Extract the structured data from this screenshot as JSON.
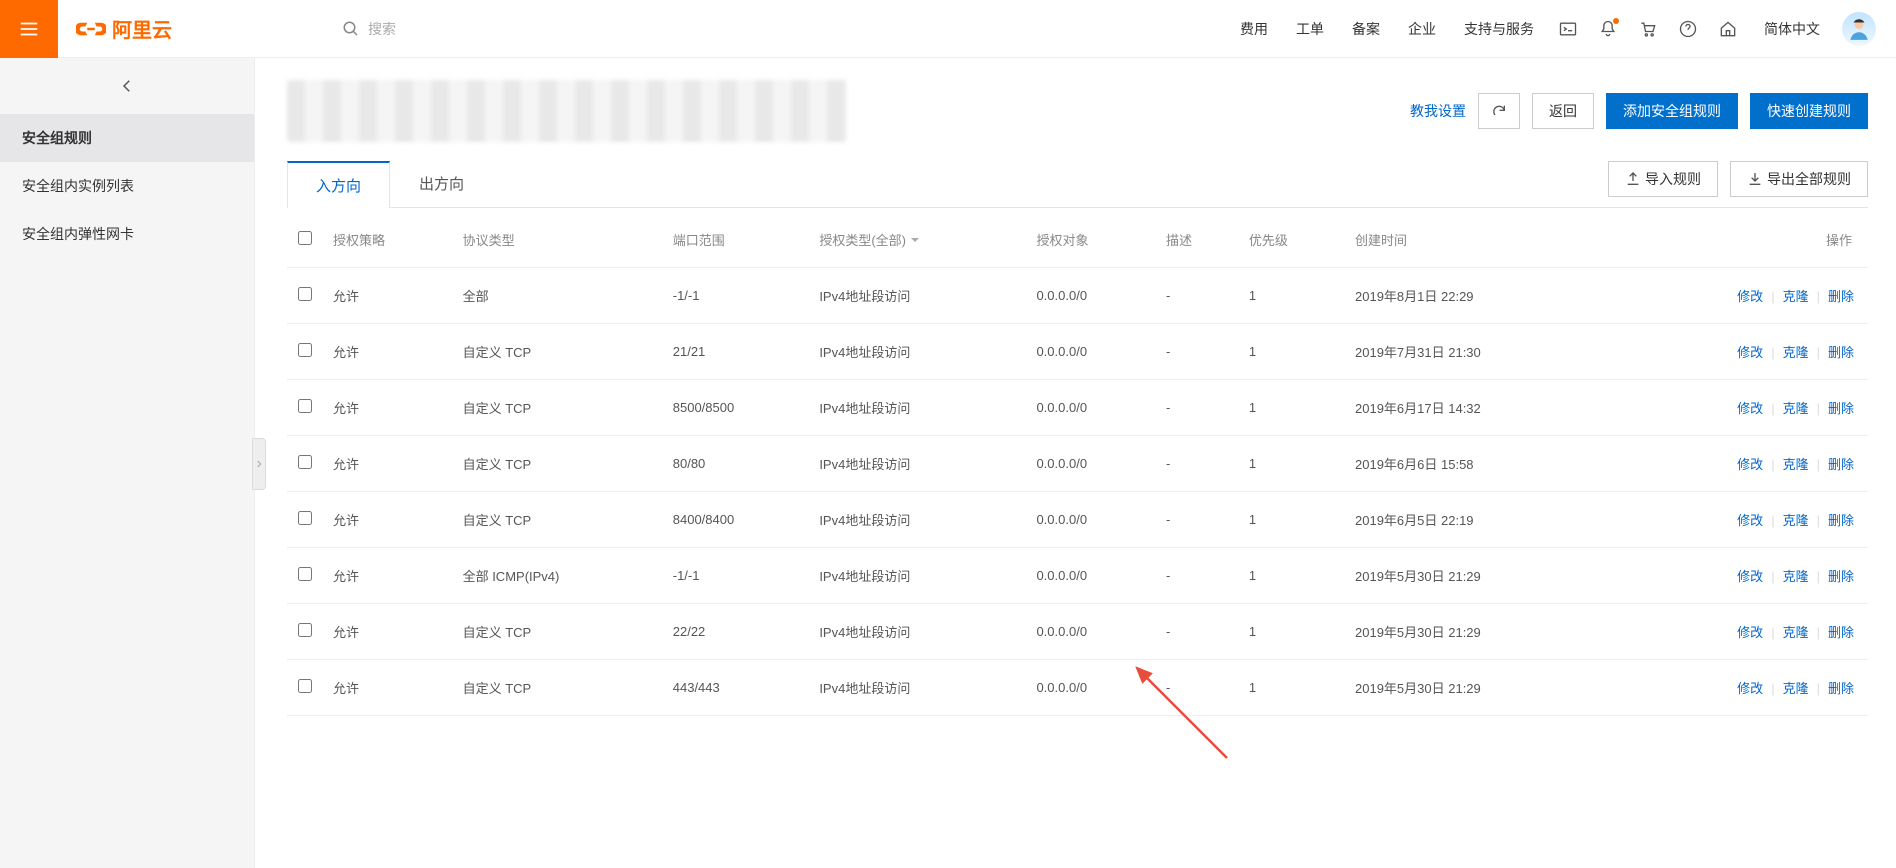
{
  "header": {
    "brand": "阿里云",
    "search_placeholder": "搜索",
    "nav": [
      "费用",
      "工单",
      "备案",
      "企业",
      "支持与服务"
    ],
    "lang": "简体中文"
  },
  "sidebar": {
    "items": [
      {
        "label": "安全组规则",
        "active": true
      },
      {
        "label": "安全组内实例列表",
        "active": false
      },
      {
        "label": "安全组内弹性网卡",
        "active": false
      }
    ]
  },
  "page": {
    "tutorial_link": "教我设置",
    "back_btn": "返回",
    "add_rule_btn": "添加安全组规则",
    "quick_create_btn": "快速创建规则",
    "import_btn": "导入规则",
    "export_btn": "导出全部规则"
  },
  "tabs": [
    {
      "label": "入方向",
      "active": true
    },
    {
      "label": "出方向",
      "active": false
    }
  ],
  "columns": {
    "policy": "授权策略",
    "protocol": "协议类型",
    "port": "端口范围",
    "auth_type": "授权类型(全部)",
    "auth_obj": "授权对象",
    "desc": "描述",
    "priority": "优先级",
    "created": "创建时间",
    "ops": "操作"
  },
  "ops": {
    "modify": "修改",
    "clone": "克隆",
    "delete": "删除"
  },
  "rows": [
    {
      "policy": "允许",
      "protocol": "全部",
      "port": "-1/-1",
      "auth_type": "IPv4地址段访问",
      "auth_obj": "0.0.0.0/0",
      "desc": "-",
      "priority": "1",
      "created": "2019年8月1日 22:29"
    },
    {
      "policy": "允许",
      "protocol": "自定义 TCP",
      "port": "21/21",
      "auth_type": "IPv4地址段访问",
      "auth_obj": "0.0.0.0/0",
      "desc": "-",
      "priority": "1",
      "created": "2019年7月31日 21:30"
    },
    {
      "policy": "允许",
      "protocol": "自定义 TCP",
      "port": "8500/8500",
      "auth_type": "IPv4地址段访问",
      "auth_obj": "0.0.0.0/0",
      "desc": "-",
      "priority": "1",
      "created": "2019年6月17日 14:32"
    },
    {
      "policy": "允许",
      "protocol": "自定义 TCP",
      "port": "80/80",
      "auth_type": "IPv4地址段访问",
      "auth_obj": "0.0.0.0/0",
      "desc": "-",
      "priority": "1",
      "created": "2019年6月6日 15:58"
    },
    {
      "policy": "允许",
      "protocol": "自定义 TCP",
      "port": "8400/8400",
      "auth_type": "IPv4地址段访问",
      "auth_obj": "0.0.0.0/0",
      "desc": "-",
      "priority": "1",
      "created": "2019年6月5日 22:19"
    },
    {
      "policy": "允许",
      "protocol": "全部 ICMP(IPv4)",
      "port": "-1/-1",
      "auth_type": "IPv4地址段访问",
      "auth_obj": "0.0.0.0/0",
      "desc": "-",
      "priority": "1",
      "created": "2019年5月30日 21:29"
    },
    {
      "policy": "允许",
      "protocol": "自定义 TCP",
      "port": "22/22",
      "auth_type": "IPv4地址段访问",
      "auth_obj": "0.0.0.0/0",
      "desc": "-",
      "priority": "1",
      "created": "2019年5月30日 21:29"
    },
    {
      "policy": "允许",
      "protocol": "自定义 TCP",
      "port": "443/443",
      "auth_type": "IPv4地址段访问",
      "auth_obj": "0.0.0.0/0",
      "desc": "-",
      "priority": "1",
      "created": "2019年5月30日 21:29"
    }
  ]
}
